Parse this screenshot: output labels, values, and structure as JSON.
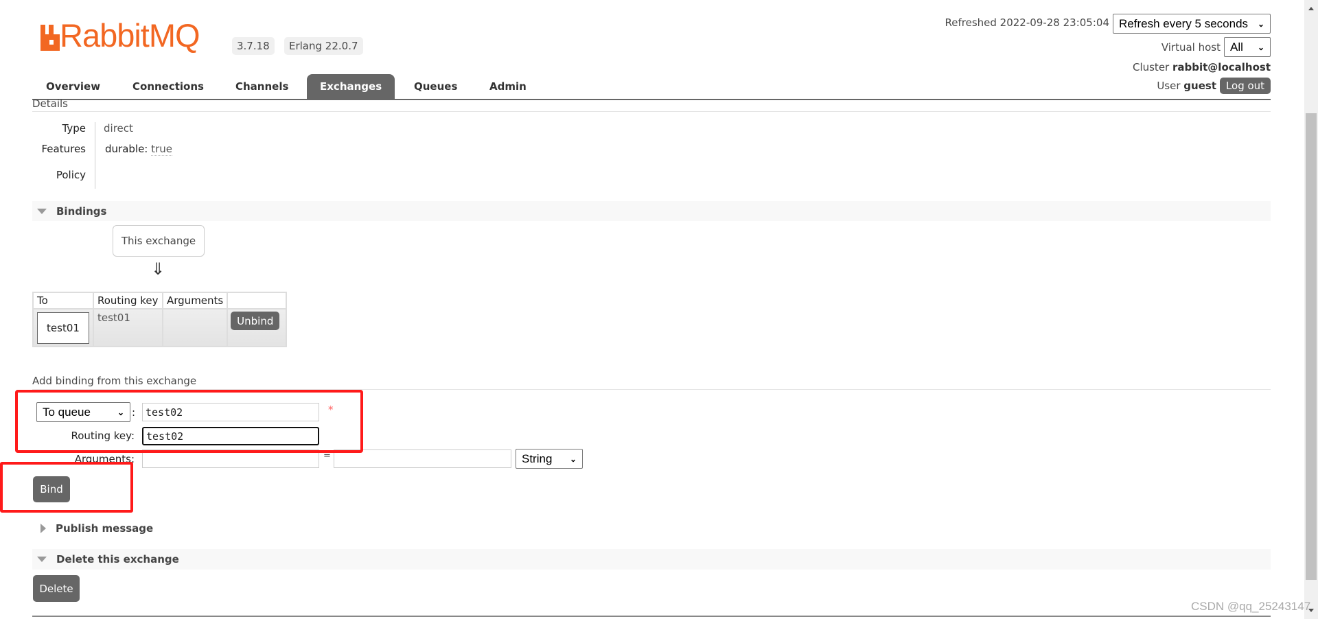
{
  "header": {
    "logo_text": "RabbitMQ",
    "version": "3.7.18",
    "erlang": "Erlang 22.0.7",
    "refreshed_label": "Refreshed 2022-09-28 23:05:04",
    "refresh_select": "Refresh every 5 seconds",
    "vhost_label": "Virtual host",
    "vhost_select": "All",
    "cluster_label": "Cluster",
    "cluster_value": "rabbit@localhost",
    "user_label": "User",
    "user_value": "guest",
    "logout": "Log out"
  },
  "tabs": [
    {
      "label": "Overview"
    },
    {
      "label": "Connections"
    },
    {
      "label": "Channels"
    },
    {
      "label": "Exchanges",
      "active": true
    },
    {
      "label": "Queues"
    },
    {
      "label": "Admin"
    }
  ],
  "details": {
    "title": "Details",
    "type_label": "Type",
    "type_value": "direct",
    "features_label": "Features",
    "features_key": "durable:",
    "features_value": "true",
    "policy_label": "Policy"
  },
  "bindings": {
    "title": "Bindings",
    "this_exchange": "This exchange",
    "arrow": "⇓",
    "columns": [
      "To",
      "Routing key",
      "Arguments",
      ""
    ],
    "rows": [
      {
        "to": "test01",
        "routing_key": "test01",
        "arguments": "",
        "action": "Unbind"
      }
    ]
  },
  "add_binding": {
    "title": "Add binding from this exchange",
    "destination_type": "To queue",
    "destination_value": "test02",
    "required_mark": "*",
    "routing_key_label": "Routing key:",
    "routing_key_value": "test02",
    "arguments_label": "Arguments:",
    "arg_key": "",
    "equals": "=",
    "arg_value": "",
    "arg_type": "String",
    "bind": "Bind"
  },
  "publish": {
    "title": "Publish message"
  },
  "delete": {
    "title": "Delete this exchange",
    "button": "Delete"
  },
  "annotation_color": "#ff1a1a",
  "watermark": "CSDN @qq_25243147"
}
